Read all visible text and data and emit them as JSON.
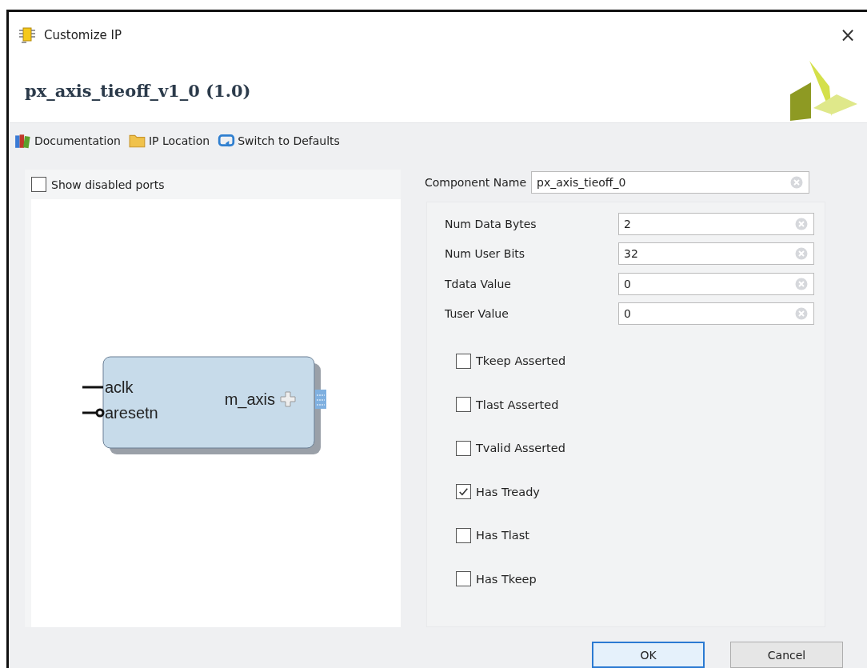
{
  "window": {
    "title": "Customize IP",
    "close": "×"
  },
  "header": {
    "title": "px_axis_tieoff_v1_0 (1.0)"
  },
  "toolbar": [
    {
      "kind": "documentation",
      "label": "Documentation"
    },
    {
      "kind": "location",
      "label": "IP Location"
    },
    {
      "kind": "defaults",
      "label": "Switch to Defaults"
    }
  ],
  "preview": {
    "show_disabled_ports": {
      "label": "Show disabled ports",
      "checked": false
    },
    "block": {
      "inputs": [
        {
          "name": "aclk",
          "kind": "clock"
        },
        {
          "name": "aresetn",
          "kind": "reset"
        }
      ],
      "outputs": [
        {
          "name": "m_axis"
        }
      ]
    }
  },
  "component_name": {
    "label": "Component Name",
    "value": "px_axis_tieoff_0"
  },
  "parameters": [
    {
      "label": "Num Data Bytes",
      "value": "2"
    },
    {
      "label": "Num User Bits",
      "value": "32"
    },
    {
      "label": "Tdata Value",
      "value": "0"
    },
    {
      "label": "Tuser Value",
      "value": "0"
    }
  ],
  "options": [
    {
      "label": "Tkeep Asserted",
      "checked": false
    },
    {
      "label": "Tlast Asserted",
      "checked": false
    },
    {
      "label": "Tvalid Asserted",
      "checked": false
    },
    {
      "label": "Has Tready",
      "checked": true
    },
    {
      "label": "Has Tlast",
      "checked": false
    },
    {
      "label": "Has Tkeep",
      "checked": false
    }
  ],
  "buttons": [
    {
      "label": "OK",
      "default": true
    },
    {
      "label": "Cancel",
      "default": false
    }
  ]
}
